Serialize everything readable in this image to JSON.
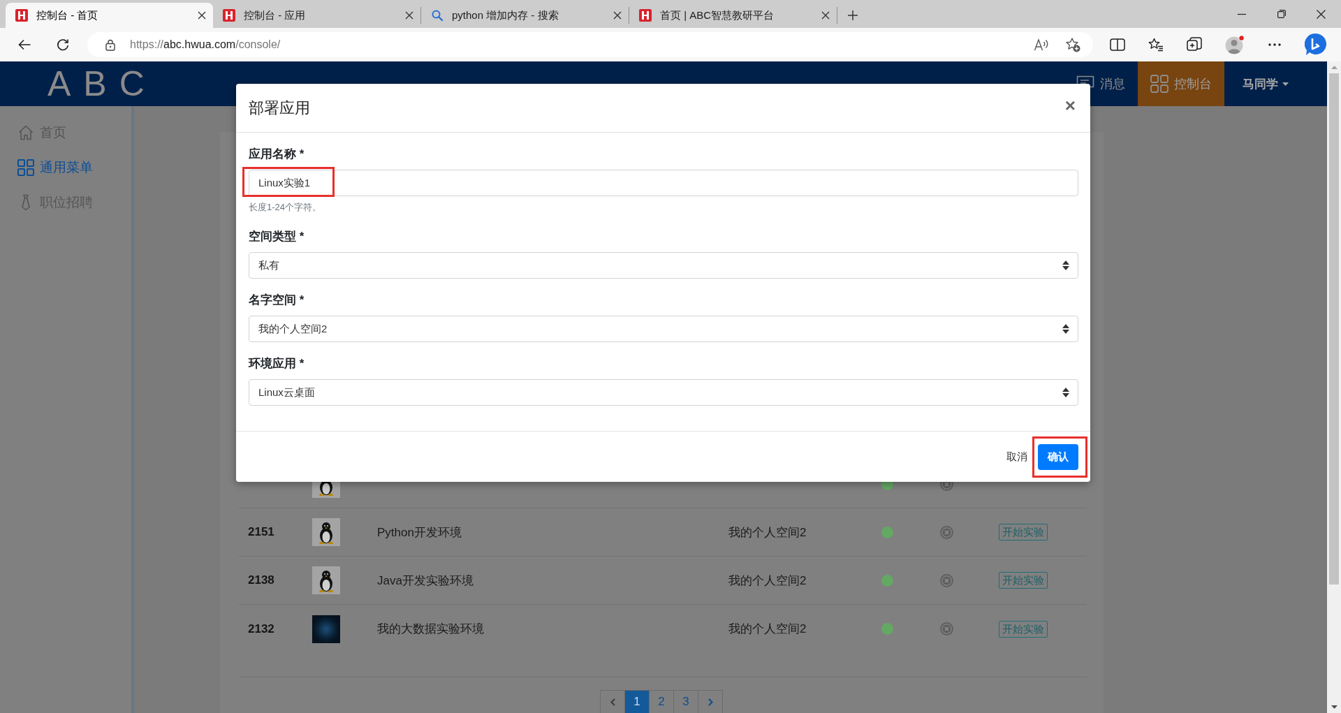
{
  "browser": {
    "tabs": [
      {
        "title": "控制台 - 首页",
        "kind": "site",
        "selected": true
      },
      {
        "title": "控制台 - 应用",
        "kind": "site",
        "selected": false
      },
      {
        "title": "python 增加内存 - 搜索",
        "kind": "search",
        "selected": false
      },
      {
        "title": "首页 | ABC智慧教研平台",
        "kind": "site",
        "selected": false
      }
    ],
    "address": "https://abc.hwua.com/console/"
  },
  "header": {
    "logo": "ABC",
    "nav": [
      {
        "label": "消息",
        "selected": false
      },
      {
        "label": "控制台",
        "selected": true
      }
    ],
    "user": "马同学"
  },
  "sidebar": {
    "items": [
      {
        "label": "首页",
        "selected": false
      },
      {
        "label": "通用菜单",
        "selected": true
      },
      {
        "label": "职位招聘",
        "selected": false
      }
    ]
  },
  "table": {
    "rows": [
      {
        "kind": "penguin",
        "color": "#63a863"
      },
      {
        "id": "2151",
        "kind": "penguin",
        "name": "Python开发环境",
        "namespace": "我的个人空间2",
        "color": "#63a863",
        "action": "开始实验"
      },
      {
        "id": "2138",
        "kind": "penguin",
        "name": "Java开发实验环境",
        "namespace": "我的个人空间2",
        "color": "#63a863",
        "action": "开始实验"
      },
      {
        "id": "2132",
        "kind": "dark",
        "name": "我的大数据实验环境",
        "namespace": "我的个人空间2",
        "color": "#63a863",
        "action": "开始实验"
      }
    ]
  },
  "pagination": {
    "pages": [
      {
        "label": "1",
        "selected": true
      },
      {
        "label": "2",
        "selected": false
      },
      {
        "label": "3",
        "selected": false
      }
    ]
  },
  "modal": {
    "title": "部署应用",
    "close": "×",
    "fields": [
      {
        "label": "应用名称 *",
        "kind": "input",
        "value": "Linux实验1",
        "hint": "长度1-24个字符。",
        "highlighted": true
      },
      {
        "label": "空间类型 *",
        "kind": "select",
        "value": "私有",
        "highlighted": false
      },
      {
        "label": "名字空间 *",
        "kind": "select",
        "value": "我的个人空间2",
        "highlighted": false
      },
      {
        "label": "环境应用 *",
        "kind": "select",
        "value": "Linux云桌面",
        "highlighted": false
      }
    ],
    "buttons": [
      {
        "label": "取消",
        "kind": "plain",
        "highlighted": false
      },
      {
        "label": "确认",
        "kind": "primary",
        "highlighted": true
      }
    ]
  }
}
